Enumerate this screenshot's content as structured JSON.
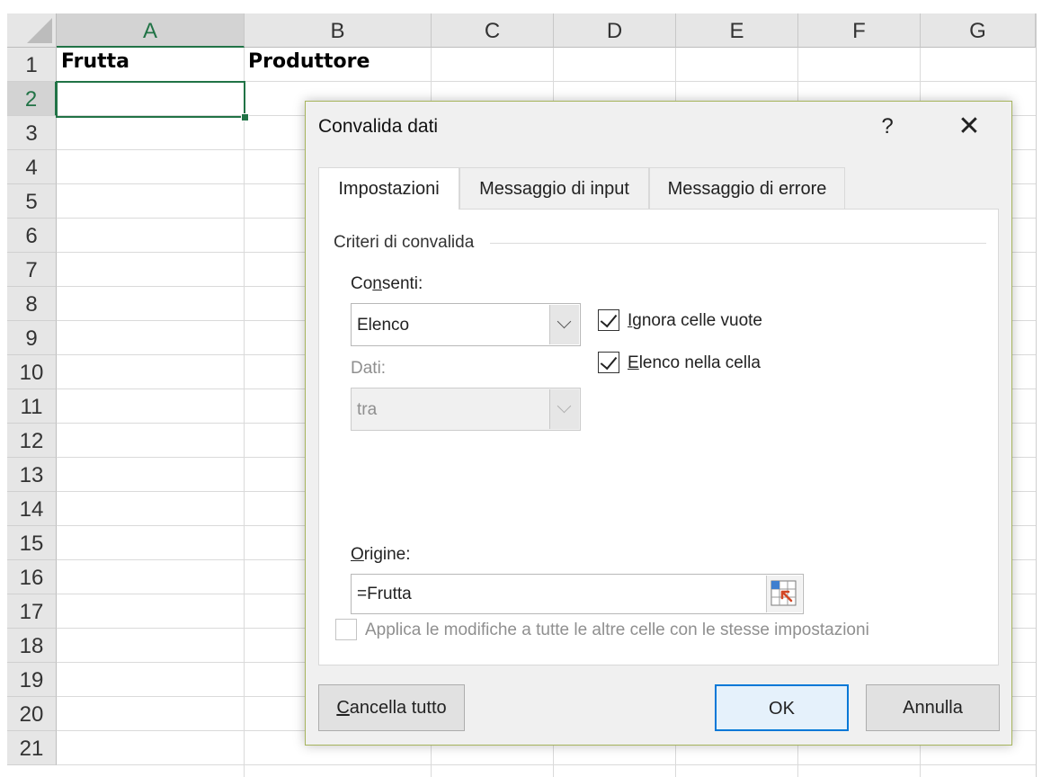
{
  "sheet": {
    "columns": [
      "A",
      "B",
      "C",
      "D",
      "E",
      "F",
      "G"
    ],
    "rows": [
      "1",
      "2",
      "3",
      "4",
      "5",
      "6",
      "7",
      "8",
      "9",
      "10",
      "11",
      "12",
      "13",
      "14",
      "15",
      "16",
      "17",
      "18",
      "19",
      "20",
      "21"
    ],
    "cells": {
      "A1": "Frutta",
      "B1": "Produttore"
    },
    "active_cell": "A2",
    "accent_color": "#217346"
  },
  "dialog": {
    "title": "Convalida dati",
    "help_glyph": "?",
    "close_glyph": "✕",
    "tabs": [
      {
        "label": "Impostazioni",
        "active": true
      },
      {
        "label": "Messaggio di input",
        "active": false
      },
      {
        "label": "Messaggio di errore",
        "active": false
      }
    ],
    "group_label": "Criteri di convalida",
    "allow": {
      "label_pre": "Co",
      "label_key": "n",
      "label_post": "senti:",
      "value": "Elenco"
    },
    "data": {
      "label": "Dati:",
      "value": "tra",
      "disabled": true
    },
    "ignore_blank": {
      "label_key": "I",
      "label_post": "gnora celle vuote",
      "checked": true
    },
    "in_cell_dropdown": {
      "label_key": "E",
      "label_post": "lenco nella cella",
      "checked": true
    },
    "source": {
      "label_key": "O",
      "label_post": "rigine:",
      "value": "=Frutta",
      "ref_icon": "range-select-icon"
    },
    "apply_all": {
      "label": "Applica le modifiche a tutte le altre celle con le stesse impostazioni",
      "checked": false,
      "disabled": true
    },
    "buttons": {
      "clear_key": "C",
      "clear_post": "ancella tutto",
      "ok": "OK",
      "cancel": "Annulla"
    },
    "default_button_color": "#0078d7"
  }
}
